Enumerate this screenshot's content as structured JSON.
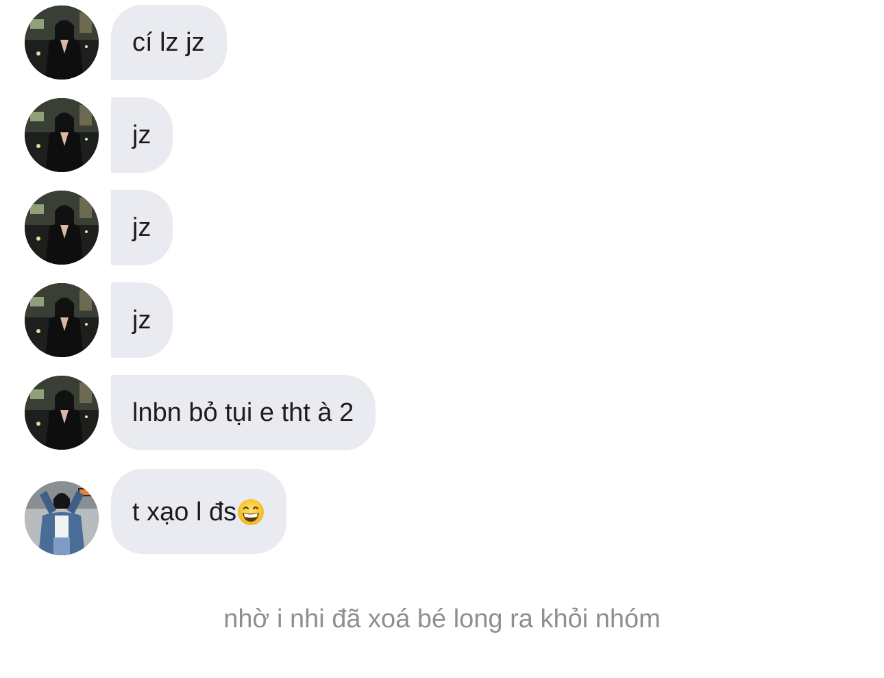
{
  "messages": [
    {
      "sender_avatar": "avatar-girl-black-dress",
      "text": "cí lz jz"
    },
    {
      "sender_avatar": "avatar-girl-black-dress",
      "text": "jz"
    },
    {
      "sender_avatar": "avatar-girl-black-dress",
      "text": "jz"
    },
    {
      "sender_avatar": "avatar-girl-black-dress",
      "text": "jz"
    },
    {
      "sender_avatar": "avatar-girl-black-dress",
      "text": "lnbn bỏ tụi e tht à 2"
    },
    {
      "sender_avatar": "avatar-girl-denim-jacket",
      "text": "t xạo l đs",
      "emoji": "grinning-face-with-smiling-eyes"
    }
  ],
  "system_notice": "nhờ i nhi đã xoá bé long ra khỏi nhóm",
  "colors": {
    "bubble_background": "#e9ebf0",
    "bubble_text": "#1c1c1e",
    "system_text": "#8e8e93",
    "page_background": "#ffffff"
  }
}
